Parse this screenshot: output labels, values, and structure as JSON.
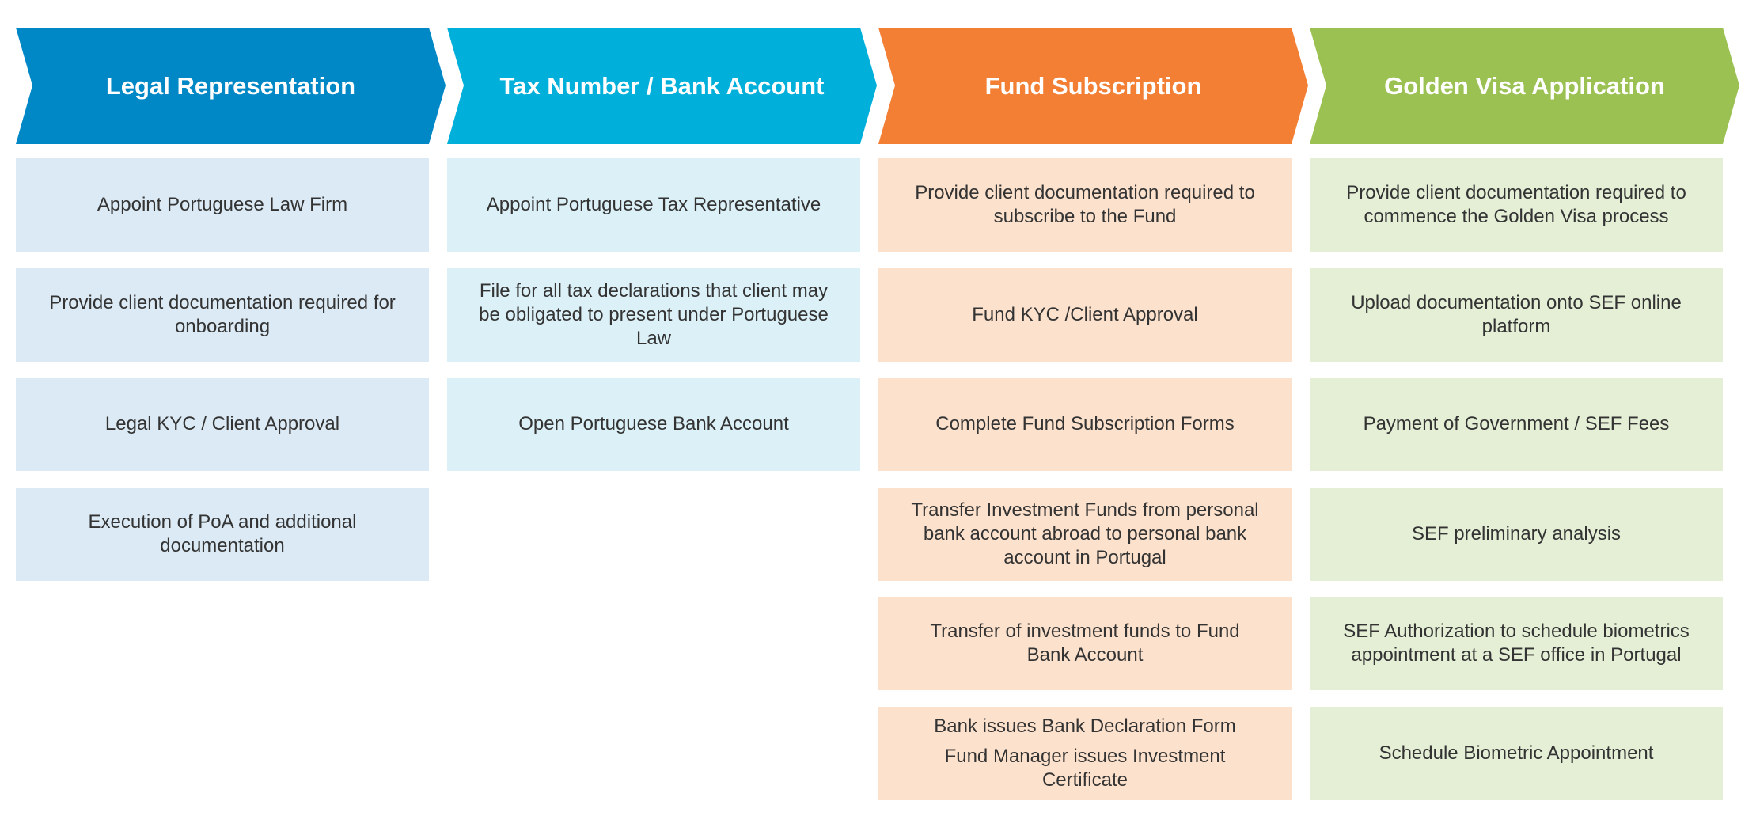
{
  "stages": [
    {
      "title": "Legal Representation",
      "header_color": "#0088c6",
      "card_color": "#dbeaf4",
      "steps": [
        [
          "Appoint Portuguese Law Firm"
        ],
        [
          "Provide client documentation required for onboarding"
        ],
        [
          "Legal KYC / Client Approval"
        ],
        [
          "Execution of PoA and additional documentation"
        ]
      ]
    },
    {
      "title": "Tax Number / Bank Account",
      "header_color": "#00b0da",
      "card_color": "#dcf0f7",
      "steps": [
        [
          "Appoint Portuguese Tax Representative"
        ],
        [
          "File for all tax declarations that client may be obligated to present under Portuguese Law"
        ],
        [
          "Open Portuguese Bank Account"
        ]
      ]
    },
    {
      "title": "Fund Subscription",
      "header_color": "#f37f35",
      "card_color": "#fce1cc",
      "steps": [
        [
          "Provide client documentation required to subscribe to the Fund"
        ],
        [
          "Fund KYC /Client Approval"
        ],
        [
          "Complete Fund Subscription Forms"
        ],
        [
          "Transfer Investment Funds from personal bank account abroad to personal bank account in Portugal"
        ],
        [
          "Transfer of investment funds to Fund Bank Account"
        ],
        [
          "Bank issues Bank Declaration Form",
          "Fund Manager issues Investment Certificate"
        ]
      ]
    },
    {
      "title": "Golden Visa Application",
      "header_color": "#9bc153",
      "card_color": "#e4efd6",
      "steps": [
        [
          "Provide client documentation required to commence the Golden Visa process"
        ],
        [
          "Upload documentation onto SEF online platform"
        ],
        [
          "Payment of Government / SEF Fees"
        ],
        [
          "SEF preliminary analysis"
        ],
        [
          "SEF Authorization to schedule biometrics appointment at a SEF office in Portugal"
        ],
        [
          "Schedule Biometric Appointment"
        ]
      ]
    }
  ]
}
